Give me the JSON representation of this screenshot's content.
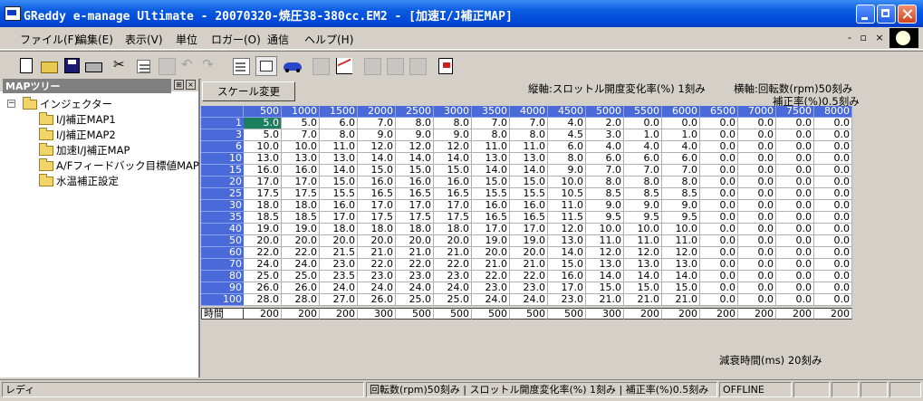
{
  "window": {
    "title": "GReddy e-manage Ultimate  - 20070320-焼圧38-380cc.EM2 - [加速I/J補正MAP]"
  },
  "menu": [
    "ファイル(F)",
    "編集(E)",
    "表示(V)",
    "単位",
    "ロガー(O)",
    "通信",
    "ヘルプ(H)"
  ],
  "mdi_controls": "- ▫ ×",
  "toolbar": {
    "icons": [
      "new-file-icon",
      "open-folder-icon",
      "save-icon",
      "print-icon",
      "cut-icon",
      "copy-icon",
      "paste-icon",
      "undo-icon",
      "redo-icon",
      "tile-icon",
      "map-view-icon",
      "car-icon",
      "list-icon",
      "graph-icon",
      "window-icon",
      "window2-icon",
      "window3-icon",
      "flag-icon"
    ]
  },
  "tree_pane": {
    "title": "MAPツリー",
    "pin": "⊞",
    "close": "×",
    "root": "インジェクター",
    "items": [
      "I/J補正MAP1",
      "I/J補正MAP2",
      "加速I/J補正MAP",
      "A/Fフィードバック目標値MAP",
      "水温補正設定"
    ]
  },
  "main": {
    "scale_button": "スケール変更",
    "vertical_axis": "縦軸:スロットル開度変化率(%) 1刻み",
    "horizontal_axis": "横軸:回転数(rpm)50刻み",
    "correction": "補正率(%)0.5刻み",
    "decay_label": "減衰時間(ms) 20刻み"
  },
  "table": {
    "columns": [
      "500",
      "1000",
      "1500",
      "2000",
      "2500",
      "3000",
      "3500",
      "4000",
      "4500",
      "5000",
      "5500",
      "6000",
      "6500",
      "7000",
      "7500",
      "8000"
    ],
    "rows": [
      {
        "label": "1",
        "values": [
          "5.0",
          "5.0",
          "6.0",
          "7.0",
          "8.0",
          "8.0",
          "7.0",
          "7.0",
          "4.0",
          "2.0",
          "0.0",
          "0.0",
          "0.0",
          "0.0",
          "0.0",
          "0.0"
        ]
      },
      {
        "label": "3",
        "values": [
          "5.0",
          "7.0",
          "8.0",
          "9.0",
          "9.0",
          "9.0",
          "8.0",
          "8.0",
          "4.5",
          "3.0",
          "1.0",
          "1.0",
          "0.0",
          "0.0",
          "0.0",
          "0.0"
        ]
      },
      {
        "label": "6",
        "values": [
          "10.0",
          "10.0",
          "11.0",
          "12.0",
          "12.0",
          "12.0",
          "11.0",
          "11.0",
          "6.0",
          "4.0",
          "4.0",
          "4.0",
          "0.0",
          "0.0",
          "0.0",
          "0.0"
        ]
      },
      {
        "label": "10",
        "values": [
          "13.0",
          "13.0",
          "13.0",
          "14.0",
          "14.0",
          "14.0",
          "13.0",
          "13.0",
          "8.0",
          "6.0",
          "6.0",
          "6.0",
          "0.0",
          "0.0",
          "0.0",
          "0.0"
        ]
      },
      {
        "label": "15",
        "values": [
          "16.0",
          "16.0",
          "14.0",
          "15.0",
          "15.0",
          "15.0",
          "14.0",
          "14.0",
          "9.0",
          "7.0",
          "7.0",
          "7.0",
          "0.0",
          "0.0",
          "0.0",
          "0.0"
        ]
      },
      {
        "label": "20",
        "values": [
          "17.0",
          "17.0",
          "15.0",
          "16.0",
          "16.0",
          "16.0",
          "15.0",
          "15.0",
          "10.0",
          "8.0",
          "8.0",
          "8.0",
          "0.0",
          "0.0",
          "0.0",
          "0.0"
        ]
      },
      {
        "label": "25",
        "values": [
          "17.5",
          "17.5",
          "15.5",
          "16.5",
          "16.5",
          "16.5",
          "15.5",
          "15.5",
          "10.5",
          "8.5",
          "8.5",
          "8.5",
          "0.0",
          "0.0",
          "0.0",
          "0.0"
        ]
      },
      {
        "label": "30",
        "values": [
          "18.0",
          "18.0",
          "16.0",
          "17.0",
          "17.0",
          "17.0",
          "16.0",
          "16.0",
          "11.0",
          "9.0",
          "9.0",
          "9.0",
          "0.0",
          "0.0",
          "0.0",
          "0.0"
        ]
      },
      {
        "label": "35",
        "values": [
          "18.5",
          "18.5",
          "17.0",
          "17.5",
          "17.5",
          "17.5",
          "16.5",
          "16.5",
          "11.5",
          "9.5",
          "9.5",
          "9.5",
          "0.0",
          "0.0",
          "0.0",
          "0.0"
        ]
      },
      {
        "label": "40",
        "values": [
          "19.0",
          "19.0",
          "18.0",
          "18.0",
          "18.0",
          "18.0",
          "17.0",
          "17.0",
          "12.0",
          "10.0",
          "10.0",
          "10.0",
          "0.0",
          "0.0",
          "0.0",
          "0.0"
        ]
      },
      {
        "label": "50",
        "values": [
          "20.0",
          "20.0",
          "20.0",
          "20.0",
          "20.0",
          "20.0",
          "19.0",
          "19.0",
          "13.0",
          "11.0",
          "11.0",
          "11.0",
          "0.0",
          "0.0",
          "0.0",
          "0.0"
        ]
      },
      {
        "label": "60",
        "values": [
          "22.0",
          "22.0",
          "21.5",
          "21.0",
          "21.0",
          "21.0",
          "20.0",
          "20.0",
          "14.0",
          "12.0",
          "12.0",
          "12.0",
          "0.0",
          "0.0",
          "0.0",
          "0.0"
        ]
      },
      {
        "label": "70",
        "values": [
          "24.0",
          "24.0",
          "23.0",
          "22.0",
          "22.0",
          "22.0",
          "21.0",
          "21.0",
          "15.0",
          "13.0",
          "13.0",
          "13.0",
          "0.0",
          "0.0",
          "0.0",
          "0.0"
        ]
      },
      {
        "label": "80",
        "values": [
          "25.0",
          "25.0",
          "23.5",
          "23.0",
          "23.0",
          "23.0",
          "22.0",
          "22.0",
          "16.0",
          "14.0",
          "14.0",
          "14.0",
          "0.0",
          "0.0",
          "0.0",
          "0.0"
        ]
      },
      {
        "label": "90",
        "values": [
          "26.0",
          "26.0",
          "24.0",
          "24.0",
          "24.0",
          "24.0",
          "23.0",
          "23.0",
          "17.0",
          "15.0",
          "15.0",
          "15.0",
          "0.0",
          "0.0",
          "0.0",
          "0.0"
        ]
      },
      {
        "label": "100",
        "values": [
          "28.0",
          "28.0",
          "27.0",
          "26.0",
          "25.0",
          "25.0",
          "24.0",
          "24.0",
          "23.0",
          "21.0",
          "21.0",
          "21.0",
          "0.0",
          "0.0",
          "0.0",
          "0.0"
        ]
      }
    ],
    "footer": {
      "label": "時間",
      "values": [
        "200",
        "200",
        "200",
        "300",
        "500",
        "500",
        "500",
        "500",
        "500",
        "300",
        "200",
        "200",
        "200",
        "200",
        "200",
        "200"
      ]
    }
  },
  "statusbar": {
    "ready": "レディ",
    "info": "回転数(rpm)50刻み | スロットル開度変化率(%) 1刻み | 補正率(%)0.5刻み",
    "connection": "OFFLINE"
  }
}
